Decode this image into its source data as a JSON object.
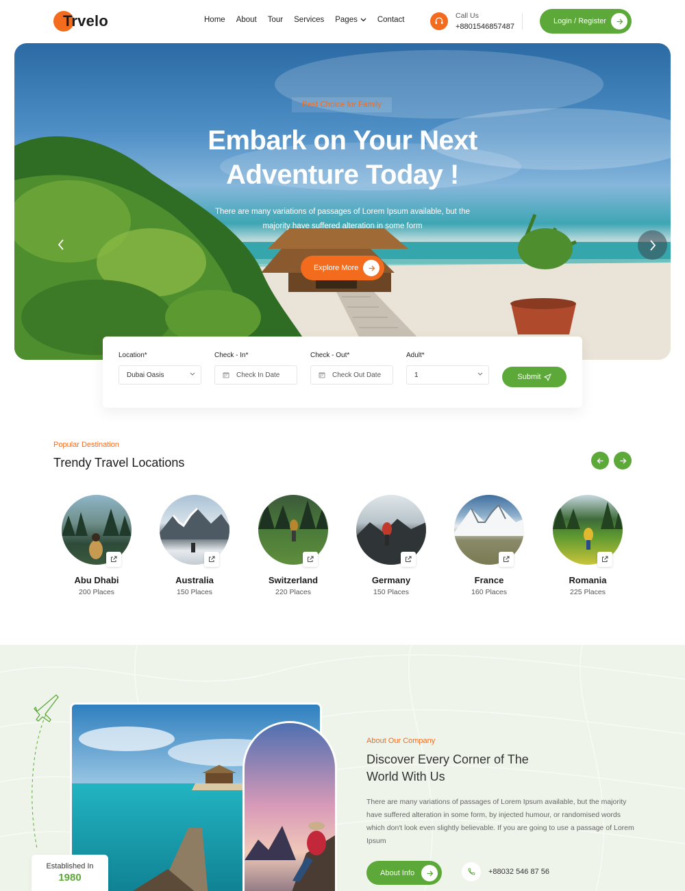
{
  "brand": {
    "name": "Trvelo",
    "accent": "#f36b1c",
    "green": "#5ca93a"
  },
  "nav": {
    "items": [
      "Home",
      "About",
      "Tour",
      "Services",
      "Pages",
      "Contact"
    ]
  },
  "call": {
    "label": "Call Us",
    "number": "+8801546857487"
  },
  "header": {
    "login_label": "Login / Register"
  },
  "hero": {
    "tag": "Best Choice for Family",
    "title_line1": "Embark on Your Next",
    "title_line2": "Adventure Today !",
    "subtitle_line1": "There are many variations of passages of Lorem Ipsum available, but the",
    "subtitle_line2": "majority have suffered alteration in some form",
    "cta_label": "Explore More"
  },
  "booking": {
    "location": {
      "label": "Location*",
      "value": "Dubai Oasis"
    },
    "check_in": {
      "label": "Check - In*",
      "placeholder": "Check In Date"
    },
    "check_out": {
      "label": "Check - Out*",
      "placeholder": "Check Out Date"
    },
    "adult": {
      "label": "Adult*",
      "value": "1"
    },
    "submit_label": "Submit"
  },
  "trending": {
    "eyebrow": "Popular Destination",
    "title": "Trendy Travel Locations",
    "destinations": [
      {
        "name": "Abu Dhabi",
        "places": "200 Places"
      },
      {
        "name": "Australia",
        "places": "150 Places"
      },
      {
        "name": "Switzerland",
        "places": "220 Places"
      },
      {
        "name": "Germany",
        "places": "150 Places"
      },
      {
        "name": "France",
        "places": "160 Places"
      },
      {
        "name": "Romania",
        "places": "225 Places"
      }
    ]
  },
  "about": {
    "established_label": "Established In",
    "established_year": "1980",
    "eyebrow": "About Our Company",
    "title_line1": "Discover Every Corner of The",
    "title_line2": "World With Us",
    "text": "There are many variations of passages of Lorem Ipsum available, but the majority have suffered alteration in some form, by injected humour, or randomised words which don't look even slightly believable. If you are going to use a passage of Lorem Ipsum",
    "cta_label": "About Info",
    "phone": "+88032 546 87 56"
  },
  "icons": {
    "headset": "headset-icon",
    "arrow": "arrow-right-icon",
    "calendar": "calendar-icon",
    "send": "send-icon",
    "external": "external-link-icon",
    "plane": "plane-icon",
    "phone": "phone-icon"
  }
}
